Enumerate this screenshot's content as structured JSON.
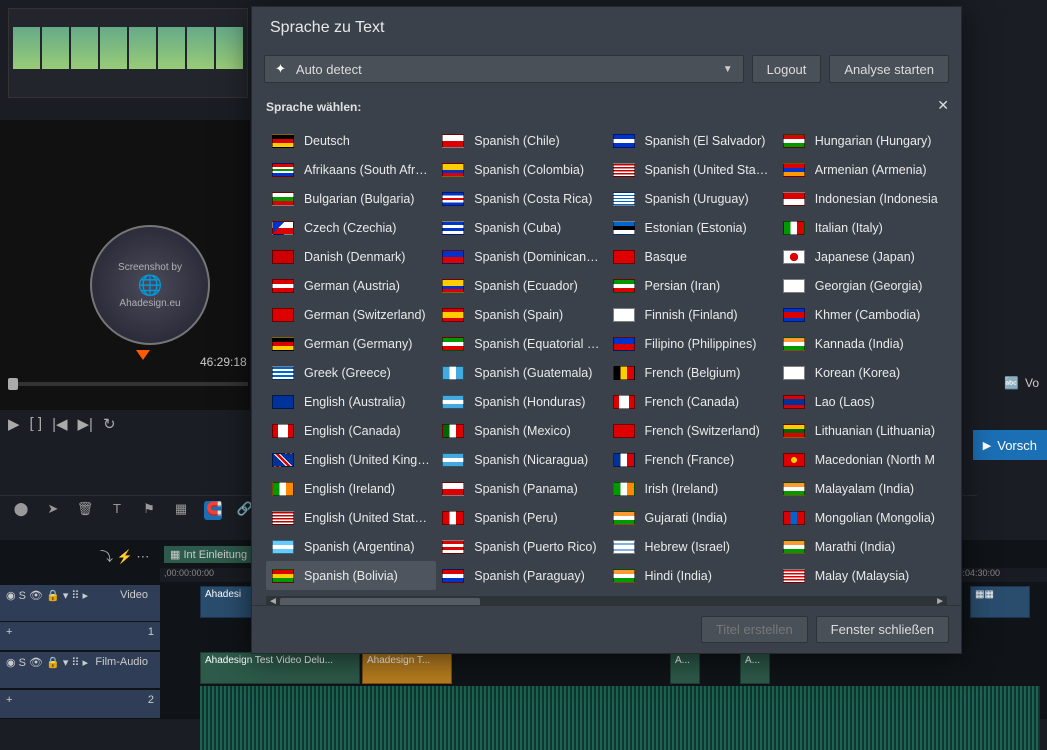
{
  "background": {
    "timecode": "46:29:18",
    "watermark_top": "Screenshot by",
    "watermark_bottom": "Ahadesign.eu",
    "vo_label": "Vo",
    "vorschau_label": "Vorsch",
    "ruler_start": ",00:00:00:00",
    "ruler_end": ",00:04:30:00",
    "track_top_label": "Einleitung",
    "track_video_label": "Video",
    "track_video_num": "1",
    "track_audio_label": "Film-Audio",
    "track_audio_num": "2",
    "clip_blue": "Ahadesi",
    "clip_green1": "Ahadesign Test Video Delu...",
    "clip_orange": "Ahadesign T...",
    "clip_green2_a": "A...",
    "clip_green2_b": "A..."
  },
  "dialog": {
    "title": "Sprache zu Text",
    "dropdown_label": "Auto detect",
    "logout_label": "Logout",
    "analyse_label": "Analyse starten",
    "section_label": "Sprache wählen:",
    "titel_label": "Titel erstellen",
    "close_label": "Fenster schließen"
  },
  "languages": [
    {
      "label": "Deutsch",
      "flag": "linear-gradient(#000 33%,#d00 33% 66%,#fc0 66%)"
    },
    {
      "label": "Afrikaans (South Africa)",
      "flag": "linear-gradient(#d00 25%,#fff 25% 40%,#090 40% 60%,#fff 60% 75%,#03c 75%)"
    },
    {
      "label": "Bulgarian (Bulgaria)",
      "flag": "linear-gradient(#fff 33%,#090 33% 66%,#d00 66%)"
    },
    {
      "label": "Czech (Czechia)",
      "flag": "linear-gradient(135deg,#03c 35%,transparent 35%),linear-gradient(#fff 50%,#d00 50%)"
    },
    {
      "label": "Danish (Denmark)",
      "flag": "linear-gradient(#c00,#c00)"
    },
    {
      "label": "German (Austria)",
      "flag": "linear-gradient(#d00 33%,#fff 33% 66%,#d00 66%)"
    },
    {
      "label": "German (Switzerland)",
      "flag": "linear-gradient(#d00,#d00)"
    },
    {
      "label": "German (Germany)",
      "flag": "linear-gradient(#000 33%,#d00 33% 66%,#fc0 66%)"
    },
    {
      "label": "Greek (Greece)",
      "flag": "repeating-linear-gradient(#06c 0 2px,#fff 2px 4px)"
    },
    {
      "label": "English (Australia)",
      "flag": "linear-gradient(#039,#039)"
    },
    {
      "label": "English (Canada)",
      "flag": "linear-gradient(90deg,#d00 25%,#fff 25% 75%,#d00 75%)"
    },
    {
      "label": "English (United Kingdom)",
      "flag": "linear-gradient(45deg,#039 40%,#fff 40% 45%,#d00 45% 55%,#fff 55% 60%,#039 60%)"
    },
    {
      "label": "English (Ireland)",
      "flag": "linear-gradient(90deg,#090 33%,#fff 33% 66%,#f80 66%)"
    },
    {
      "label": "English (United States)",
      "flag": "repeating-linear-gradient(#b00 0 1.5px,#fff 1.5px 3px)"
    },
    {
      "label": "Spanish (Argentina)",
      "flag": "linear-gradient(#6cf 33%,#fff 33% 66%,#6cf 66%)"
    },
    {
      "label": "Spanish (Bolivia)",
      "flag": "linear-gradient(#d00 33%,#fc0 33% 66%,#090 66%)",
      "selected": true
    },
    {
      "label": "Spanish (Chile)",
      "flag": "linear-gradient(#fff 50%,#d00 50%)"
    },
    {
      "label": "Spanish (Colombia)",
      "flag": "linear-gradient(#fc0 50%,#03c 50% 75%,#d00 75%)"
    },
    {
      "label": "Spanish (Costa Rica)",
      "flag": "linear-gradient(#03c 20%,#fff 20% 40%,#d00 40% 60%,#fff 60% 80%,#03c 80%)"
    },
    {
      "label": "Spanish (Cuba)",
      "flag": "repeating-linear-gradient(#03c 0 3px,#fff 3px 6px)"
    },
    {
      "label": "Spanish (Dominican Repub",
      "flag": "linear-gradient(#03c 50%,#d00 50%)"
    },
    {
      "label": "Spanish (Ecuador)",
      "flag": "linear-gradient(#fc0 50%,#03c 50% 75%,#d00 75%)"
    },
    {
      "label": "Spanish (Spain)",
      "flag": "linear-gradient(#d00 25%,#fc0 25% 75%,#d00 75%)"
    },
    {
      "label": "Spanish (Equatorial Guinea",
      "flag": "linear-gradient(#090 33%,#fff 33% 66%,#d00 66%)"
    },
    {
      "label": "Spanish (Guatemala)",
      "flag": "linear-gradient(90deg,#4ad 33%,#fff 33% 66%,#4ad 66%)"
    },
    {
      "label": "Spanish (Honduras)",
      "flag": "linear-gradient(#4ad 33%,#fff 33% 66%,#4ad 66%)"
    },
    {
      "label": "Spanish (Mexico)",
      "flag": "linear-gradient(90deg,#060 33%,#fff 33% 66%,#d00 66%)"
    },
    {
      "label": "Spanish (Nicaragua)",
      "flag": "linear-gradient(#4ad 33%,#fff 33% 66%,#4ad 66%)"
    },
    {
      "label": "Spanish (Panama)",
      "flag": "linear-gradient(#fff 50%,#d00 50%)"
    },
    {
      "label": "Spanish (Peru)",
      "flag": "linear-gradient(90deg,#d00 33%,#fff 33% 66%,#d00 66%)"
    },
    {
      "label": "Spanish (Puerto Rico)",
      "flag": "repeating-linear-gradient(#d00 0 3px,#fff 3px 6px)"
    },
    {
      "label": "Spanish (Paraguay)",
      "flag": "linear-gradient(#d00 33%,#fff 33% 66%,#03c 66%)"
    },
    {
      "label": "Spanish (El Salvador)",
      "flag": "linear-gradient(#03c 33%,#fff 33% 66%,#03c 66%)"
    },
    {
      "label": "Spanish (United States)",
      "flag": "repeating-linear-gradient(#b00 0 1.5px,#fff 1.5px 3px)"
    },
    {
      "label": "Spanish (Uruguay)",
      "flag": "repeating-linear-gradient(#fff 0 2px,#06c 2px 3px)"
    },
    {
      "label": "Estonian (Estonia)",
      "flag": "linear-gradient(#06c 33%,#000 33% 66%,#fff 66%)"
    },
    {
      "label": "Basque",
      "flag": "linear-gradient(#d00,#d00)"
    },
    {
      "label": "Persian (Iran)",
      "flag": "linear-gradient(#090 33%,#fff 33% 66%,#d00 66%)"
    },
    {
      "label": "Finnish (Finland)",
      "flag": "linear-gradient(#fff,#fff)"
    },
    {
      "label": "Filipino (Philippines)",
      "flag": "linear-gradient(#03c 50%,#d00 50%)"
    },
    {
      "label": "French (Belgium)",
      "flag": "linear-gradient(90deg,#000 33%,#fc0 33% 66%,#d00 66%)"
    },
    {
      "label": "French (Canada)",
      "flag": "linear-gradient(90deg,#d00 25%,#fff 25% 75%,#d00 75%)"
    },
    {
      "label": "French (Switzerland)",
      "flag": "linear-gradient(#d00,#d00)"
    },
    {
      "label": "French (France)",
      "flag": "linear-gradient(90deg,#039 33%,#fff 33% 66%,#d00 66%)"
    },
    {
      "label": "Irish (Ireland)",
      "flag": "linear-gradient(90deg,#090 33%,#fff 33% 66%,#f80 66%)"
    },
    {
      "label": "Gujarati (India)",
      "flag": "linear-gradient(#f93 33%,#fff 33% 66%,#090 66%)"
    },
    {
      "label": "Hebrew (Israel)",
      "flag": "linear-gradient(#fff 20%,#06c 20% 30%,#fff 30% 70%,#06c 70% 80%,#fff 80%)"
    },
    {
      "label": "Hindi (India)",
      "flag": "linear-gradient(#f93 33%,#fff 33% 66%,#090 66%)"
    },
    {
      "label": "Hungarian (Hungary)",
      "flag": "linear-gradient(#d00 33%,#fff 33% 66%,#090 66%)"
    },
    {
      "label": "Armenian (Armenia)",
      "flag": "linear-gradient(#d00 33%,#03c 33% 66%,#f90 66%)"
    },
    {
      "label": "Indonesian (Indonesia",
      "flag": "linear-gradient(#d00 50%,#fff 50%)"
    },
    {
      "label": "Italian (Italy)",
      "flag": "linear-gradient(90deg,#090 33%,#fff 33% 66%,#d00 66%)"
    },
    {
      "label": "Japanese (Japan)",
      "flag": "radial-gradient(circle,#d00 35%,#fff 36%)"
    },
    {
      "label": "Georgian (Georgia)",
      "flag": "linear-gradient(#fff,#fff)"
    },
    {
      "label": "Khmer (Cambodia)",
      "flag": "linear-gradient(#03c 25%,#d00 25% 75%,#03c 75%)"
    },
    {
      "label": "Kannada (India)",
      "flag": "linear-gradient(#f93 33%,#fff 33% 66%,#090 66%)"
    },
    {
      "label": "Korean (Korea)",
      "flag": "linear-gradient(#fff,#fff)"
    },
    {
      "label": "Lao (Laos)",
      "flag": "linear-gradient(#d00 25%,#039 25% 75%,#d00 75%)"
    },
    {
      "label": "Lithuanian (Lithuania)",
      "flag": "linear-gradient(#fc0 33%,#060 33% 66%,#d00 66%)"
    },
    {
      "label": "Macedonian (North M",
      "flag": "radial-gradient(circle,#fc0 25%,#d00 26%)"
    },
    {
      "label": "Malayalam (India)",
      "flag": "linear-gradient(#f93 33%,#fff 33% 66%,#090 66%)"
    },
    {
      "label": "Mongolian (Mongolia)",
      "flag": "linear-gradient(90deg,#d00 33%,#06c 33% 66%,#d00 66%)"
    },
    {
      "label": "Marathi (India)",
      "flag": "linear-gradient(#f93 33%,#fff 33% 66%,#090 66%)"
    },
    {
      "label": "Malay (Malaysia)",
      "flag": "repeating-linear-gradient(#d00 0 1.5px,#fff 1.5px 3px)"
    }
  ]
}
